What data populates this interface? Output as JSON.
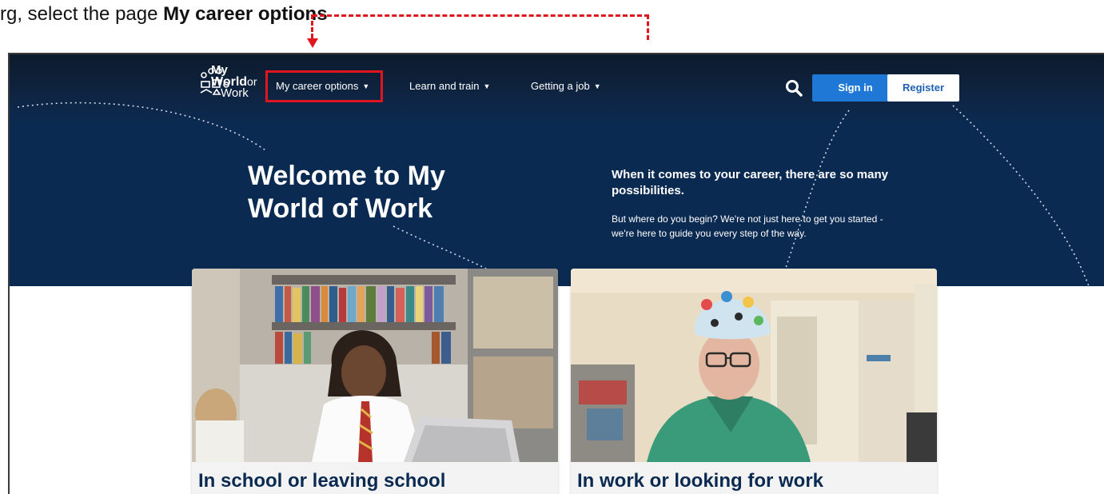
{
  "instruction": {
    "prefix": "rg",
    "mid": ", select the page",
    "bold_tail": "My career options"
  },
  "brand": {
    "logo_line1": "My",
    "logo_line2": "World",
    "logo_or": "or",
    "logo_line3": "Work"
  },
  "nav": {
    "items": [
      {
        "label": "My career options",
        "chevron": "▼"
      },
      {
        "label": "Learn and train",
        "chevron": "▼"
      },
      {
        "label": "Getting a job",
        "chevron": "▼"
      }
    ],
    "sign_in": "Sign in",
    "register": "Register",
    "search_icon": "search-icon"
  },
  "hero": {
    "title": "Welcome to My World of Work",
    "subtitle": "When it comes to your career, there are so many possibilities.",
    "body": "But where do you begin? We're not just here to get you started - we're here to guide you every step of the way."
  },
  "cards": [
    {
      "title": "In school or leaving school"
    },
    {
      "title": "In work or looking for work"
    }
  ],
  "colors": {
    "navy": "#0b2a52",
    "accent_blue": "#1f77d6",
    "annotation_red": "#e0161e"
  }
}
